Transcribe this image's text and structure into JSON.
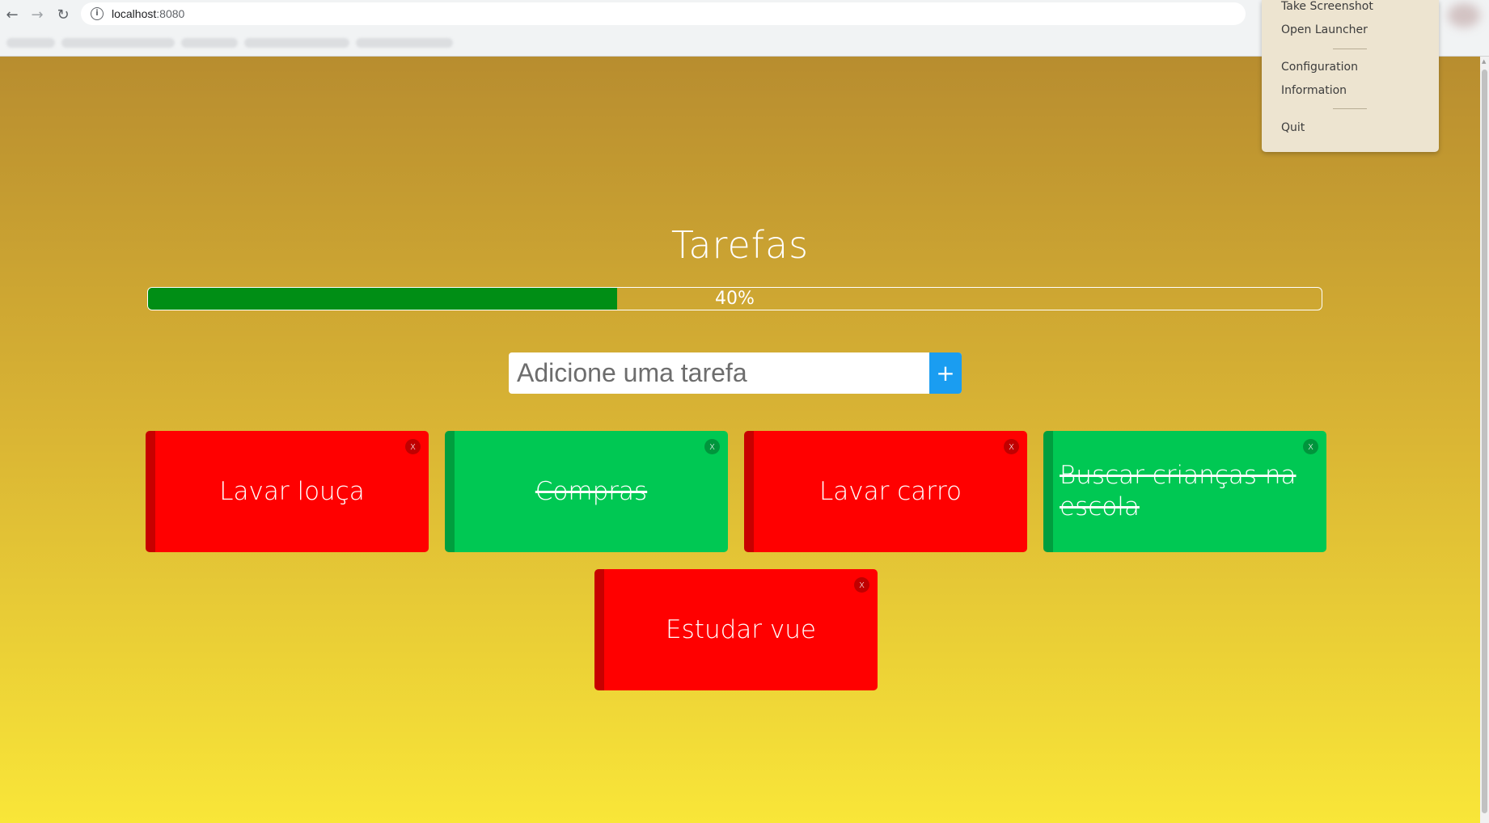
{
  "browser": {
    "url_host": "localhost",
    "url_port": ":8080"
  },
  "page": {
    "title": "Tarefas",
    "progress": {
      "value": 40,
      "label": "40%"
    },
    "new_task": {
      "placeholder": "Adicione uma tarefa",
      "add_label": "+"
    },
    "tasks": [
      {
        "name": "Lavar louça",
        "done": false,
        "close_label": "x"
      },
      {
        "name": "Compras",
        "done": true,
        "close_label": "x"
      },
      {
        "name": "Lavar carro",
        "done": false,
        "close_label": "x"
      },
      {
        "name": "Buscar crianças na escola",
        "done": true,
        "close_label": "x"
      },
      {
        "name": "Estudar vue",
        "done": false,
        "close_label": "x"
      }
    ]
  },
  "menu": {
    "items": [
      "Take Screenshot",
      "Open Launcher",
      "Configuration",
      "Information",
      "Quit"
    ]
  },
  "colors": {
    "pending": "#ff0000",
    "done": "#00c853",
    "progress": "#008e15",
    "add_button": "#1a9df1"
  }
}
